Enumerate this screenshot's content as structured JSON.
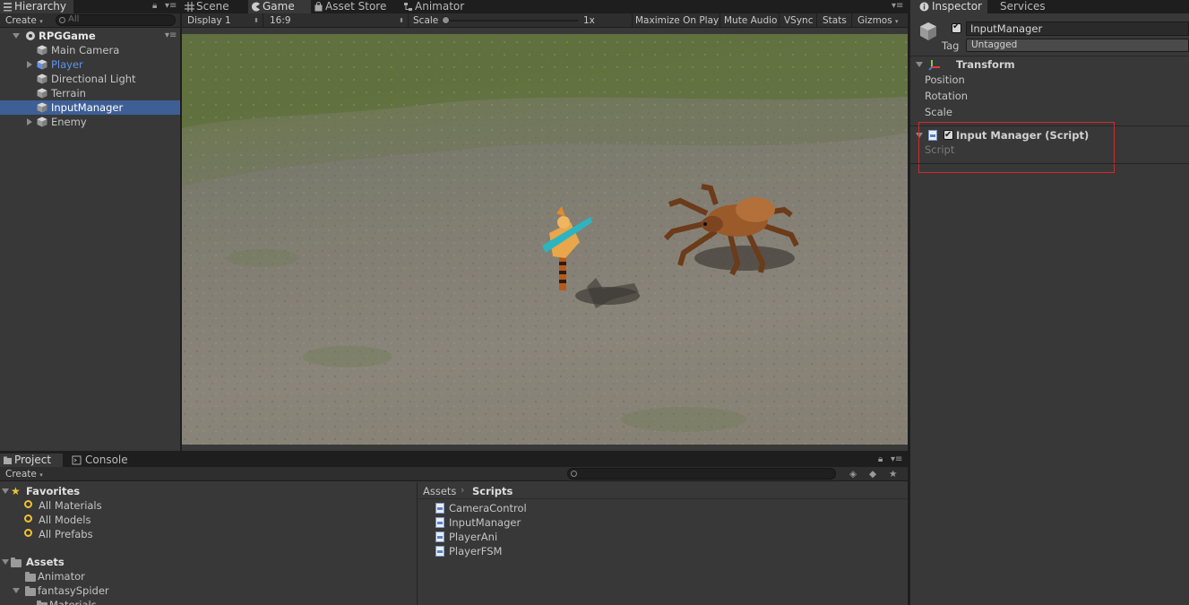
{
  "hierarchy": {
    "tab": "Hierarchy",
    "create": "Create",
    "search_placeholder": "All",
    "scene": "RPGGame",
    "items": [
      {
        "label": "Main Camera",
        "prefab": false,
        "expandable": false,
        "selected": false
      },
      {
        "label": "Player",
        "prefab": true,
        "expandable": true,
        "selected": false
      },
      {
        "label": "Directional Light",
        "prefab": false,
        "expandable": false,
        "selected": false
      },
      {
        "label": "Terrain",
        "prefab": false,
        "expandable": false,
        "selected": false
      },
      {
        "label": "InputManager",
        "prefab": false,
        "expandable": false,
        "selected": true
      },
      {
        "label": "Enemy",
        "prefab": false,
        "expandable": true,
        "selected": false
      }
    ]
  },
  "center_tabs": {
    "scene": "Scene",
    "game": "Game",
    "asset_store": "Asset Store",
    "animator": "Animator"
  },
  "game_toolbar": {
    "display": "Display 1",
    "aspect": "16:9",
    "scale_label": "Scale",
    "scale_value": "1x",
    "scale_level": 0.0,
    "maximize": "Maximize On Play",
    "mute": "Mute Audio",
    "vsync": "VSync",
    "stats": "Stats",
    "gizmos": "Gizmos"
  },
  "inspector": {
    "tab": "Inspector",
    "services_tab": "Services",
    "object_name": "InputManager",
    "active": true,
    "tag_label": "Tag",
    "tag_value": "Untagged",
    "transform": {
      "title": "Transform",
      "fields": [
        "Position",
        "Rotation",
        "Scale"
      ]
    },
    "script_component": {
      "title": "Input Manager (Script)",
      "enabled": true,
      "field": "Script",
      "highlight_color": "#d42a2a"
    }
  },
  "project": {
    "tab": "Project",
    "console_tab": "Console",
    "create": "Create",
    "favorites": {
      "title": "Favorites",
      "items": [
        "All Materials",
        "All Models",
        "All Prefabs"
      ]
    },
    "assets": {
      "title": "Assets",
      "items": [
        "Animator",
        "fantasySpider",
        "Materials"
      ]
    },
    "breadcrumb": {
      "root": "Assets",
      "current": "Scripts"
    },
    "files": [
      "CameraControl",
      "InputManager",
      "PlayerAni",
      "PlayerFSM"
    ]
  },
  "colors": {
    "selection": "#3e5f96",
    "prefab_text": "#5f93ea",
    "panel_bg": "#383838"
  }
}
